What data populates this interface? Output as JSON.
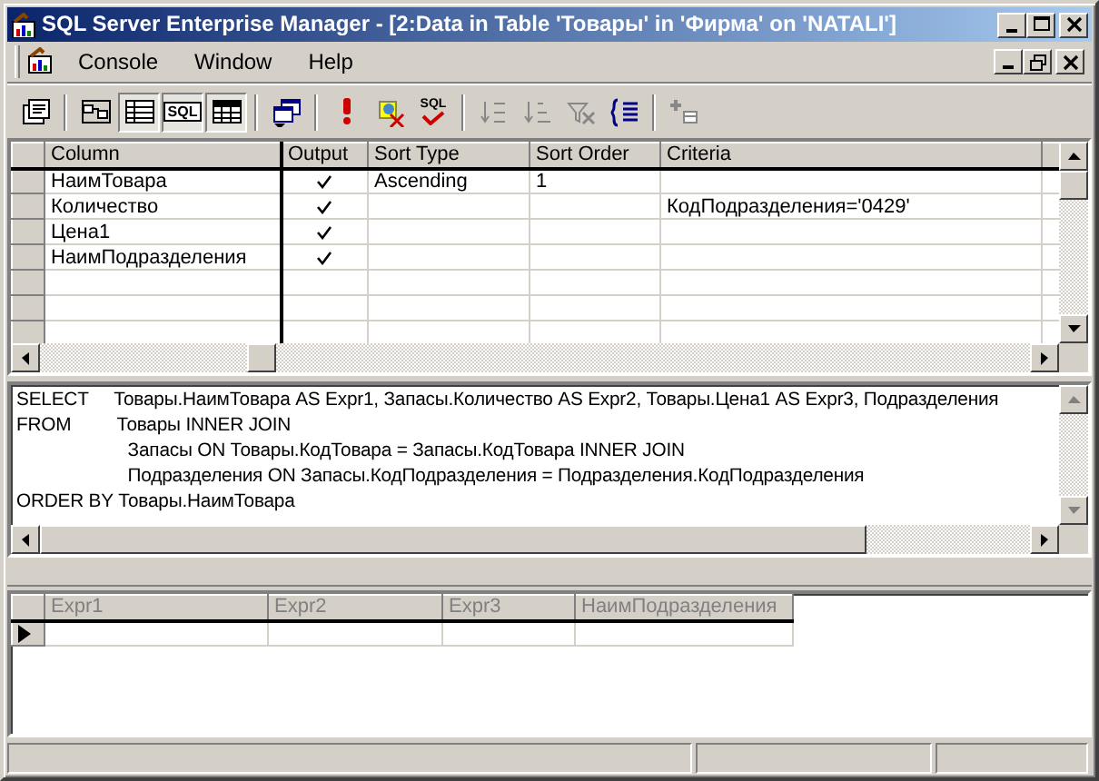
{
  "window": {
    "title": "SQL Server Enterprise Manager - [2:Data in Table 'Товары' in 'Фирма' on 'NATALI']"
  },
  "menu": [
    "Console",
    "Window",
    "Help"
  ],
  "toolbar": [
    {
      "kind": "properties",
      "pressed": false
    },
    {
      "kind": "sep"
    },
    {
      "kind": "diagram",
      "pressed": false
    },
    {
      "kind": "grid",
      "pressed": true
    },
    {
      "kind": "sql",
      "pressed": true,
      "label": "SQL"
    },
    {
      "kind": "results",
      "pressed": true
    },
    {
      "kind": "sep"
    },
    {
      "kind": "change-type",
      "pressed": false
    },
    {
      "kind": "sep"
    },
    {
      "kind": "run",
      "pressed": false
    },
    {
      "kind": "clear",
      "pressed": false
    },
    {
      "kind": "verify",
      "pressed": false,
      "label": "SQL"
    },
    {
      "kind": "sep"
    },
    {
      "kind": "sort-asc",
      "pressed": false,
      "disabled": true
    },
    {
      "kind": "sort-desc",
      "pressed": false,
      "disabled": true
    },
    {
      "kind": "remove-filter",
      "pressed": false,
      "disabled": true
    },
    {
      "kind": "group-by",
      "pressed": false
    },
    {
      "kind": "sep"
    },
    {
      "kind": "add-table",
      "pressed": false,
      "disabled": true
    }
  ],
  "criteria_grid": {
    "columns": [
      "Column",
      "Output",
      "Sort Type",
      "Sort Order",
      "Criteria"
    ],
    "rows": [
      {
        "column": "НаимТовара",
        "output": true,
        "sort_type": "Ascending",
        "sort_order": "1",
        "criteria": ""
      },
      {
        "column": "Количество",
        "output": true,
        "sort_type": "",
        "sort_order": "",
        "criteria": "КодПодразделения='0429'"
      },
      {
        "column": "Цена1",
        "output": true,
        "sort_type": "",
        "sort_order": "",
        "criteria": ""
      },
      {
        "column": "НаимПодразделения",
        "output": true,
        "sort_type": "",
        "sort_order": "",
        "criteria": ""
      }
    ]
  },
  "sql_pane": {
    "lines": [
      "SELECT     Товары.НаимТовара AS Expr1, Запасы.Количество AS Expr2, Товары.Цена1 AS Expr3, Подразделения",
      "FROM         Товары INNER JOIN",
      "                      Запасы ON Товары.КодТовара = Запасы.КодТовара INNER JOIN",
      "                      Подразделения ON Запасы.КодПодразделения = Подразделения.КодПодразделения",
      "ORDER BY Товары.НаимТовара"
    ]
  },
  "results": {
    "columns": [
      "Expr1",
      "Expr2",
      "Expr3",
      "НаимПодразделения"
    ],
    "rows": [
      {
        "current": true
      }
    ]
  }
}
